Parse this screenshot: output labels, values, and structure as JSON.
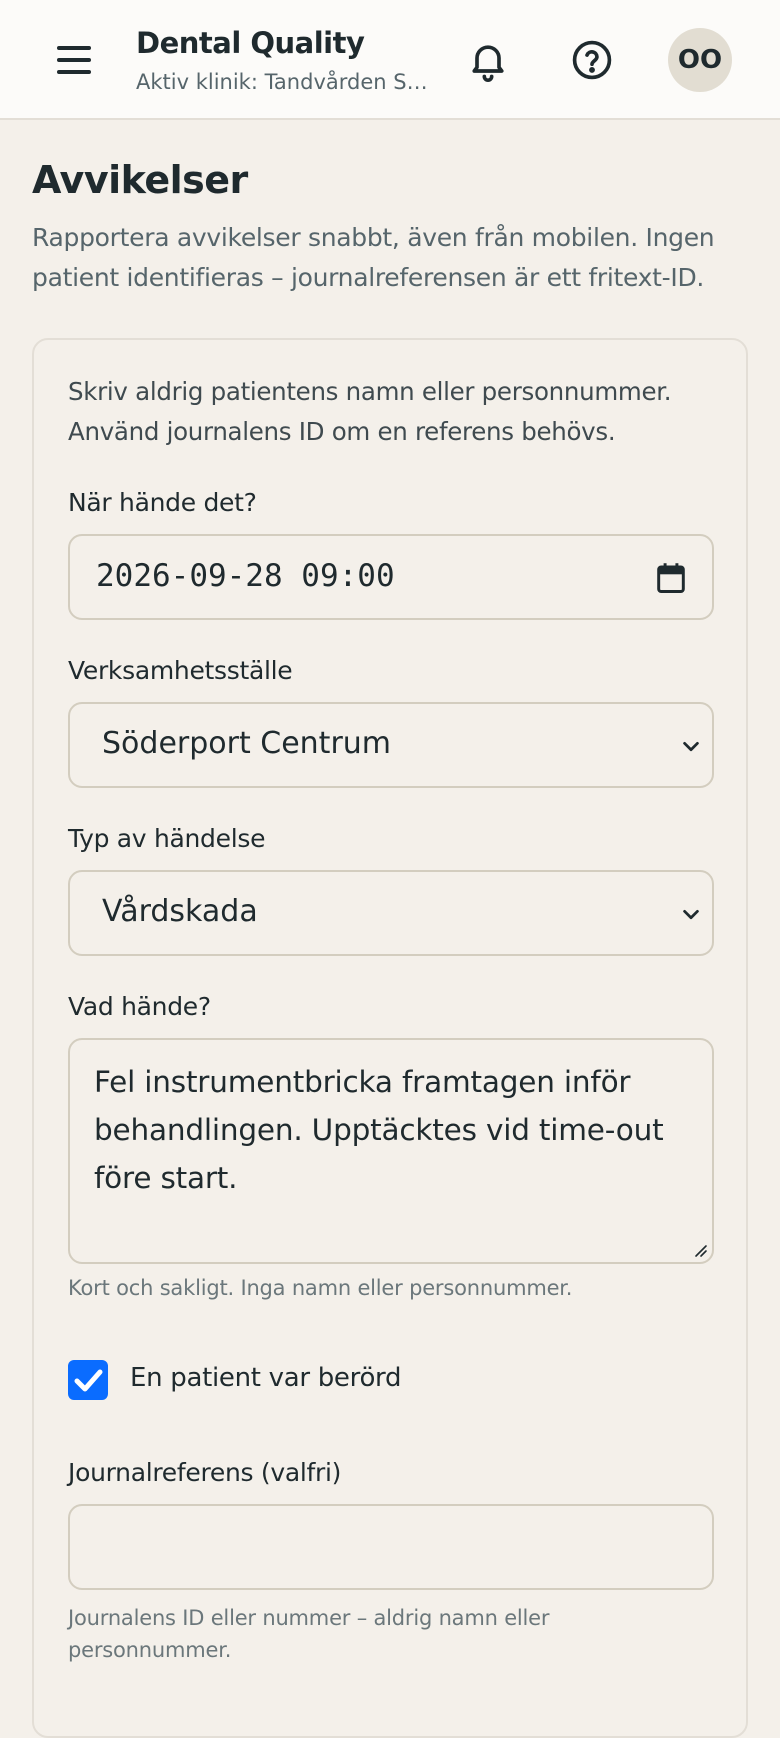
{
  "header": {
    "title": "Dental Quality",
    "subtitle": "Aktiv klinik: Tandvården S…",
    "avatar_initials": "OO"
  },
  "page": {
    "title": "Avvikelser",
    "description": "Rapportera avvikelser snabbt, även från mobilen. Ingen patient identifieras – journalreferensen är ett fritext-ID."
  },
  "form": {
    "notice": "Skriv aldrig patientens namn eller personnummer. Använd journalens ID om en referens behövs.",
    "when": {
      "label": "När hände det?",
      "value": "2026-09-28 09:00"
    },
    "location": {
      "label": "Verksamhetsställe",
      "value": "Söderport Centrum"
    },
    "event_type": {
      "label": "Typ av händelse",
      "value": "Vårdskada"
    },
    "description": {
      "label": "Vad hände?",
      "value": "Fel instrumentbricka framtagen inför behandlingen. Upptäcktes vid time-out före start.",
      "hint": "Kort och sakligt. Inga namn eller personnummer."
    },
    "patient_involved": {
      "label": "En patient var berörd",
      "checked": true
    },
    "journal_ref": {
      "label": "Journalreferens (valfri)",
      "value": "",
      "hint": "Journalens ID eller nummer – aldrig namn eller personnummer."
    }
  },
  "colors": {
    "accent": "#0a6cff",
    "background": "#f4f0ea",
    "header": "#fcfbf9"
  },
  "icons": [
    "menu-icon",
    "bell-icon",
    "help-icon",
    "calendar-icon",
    "chevron-down-icon",
    "checkmark-icon"
  ]
}
